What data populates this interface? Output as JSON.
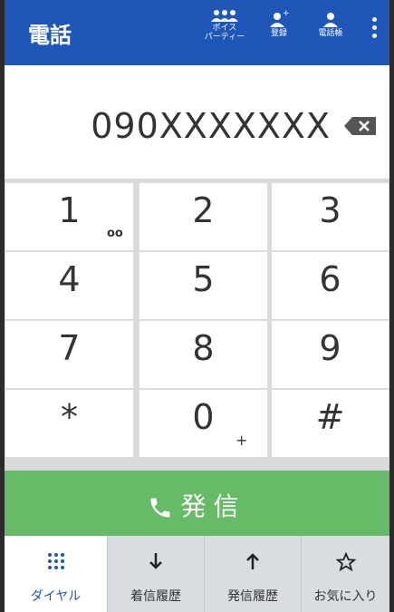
{
  "header": {
    "title": "電話",
    "voice_party_label": "ボイス\nパーティー",
    "voice_party_line1": "ボイス",
    "voice_party_line2": "パーティー",
    "register_label": "登録",
    "phonebook_label": "電話帳",
    "icons": [
      "group-people-icon",
      "add-person-icon",
      "person-icon",
      "overflow-menu-icon"
    ]
  },
  "dialer": {
    "number": "090XXXXXXX",
    "backspace_icon": "backspace-icon"
  },
  "keypad": {
    "keys": [
      {
        "digit": "1",
        "sub": "oo"
      },
      {
        "digit": "2",
        "sub": ""
      },
      {
        "digit": "3",
        "sub": ""
      },
      {
        "digit": "4",
        "sub": ""
      },
      {
        "digit": "5",
        "sub": ""
      },
      {
        "digit": "6",
        "sub": ""
      },
      {
        "digit": "7",
        "sub": ""
      },
      {
        "digit": "8",
        "sub": ""
      },
      {
        "digit": "9",
        "sub": ""
      },
      {
        "digit": "*",
        "sub": ""
      },
      {
        "digit": "0",
        "sub": "+"
      },
      {
        "digit": "#",
        "sub": ""
      }
    ]
  },
  "call": {
    "label": "発信",
    "icon": "phone-icon",
    "color": "#66bb66"
  },
  "tabs": [
    {
      "label": "ダイヤル",
      "icon": "dialpad-icon",
      "active": true
    },
    {
      "label": "着信履歴",
      "icon": "arrow-down-icon"
    },
    {
      "label": "発信履歴",
      "icon": "arrow-up-icon"
    },
    {
      "label": "お気に入り",
      "icon": "star-icon"
    }
  ],
  "colors": {
    "header": "#1e57b8",
    "accent": "#1e57b8"
  }
}
